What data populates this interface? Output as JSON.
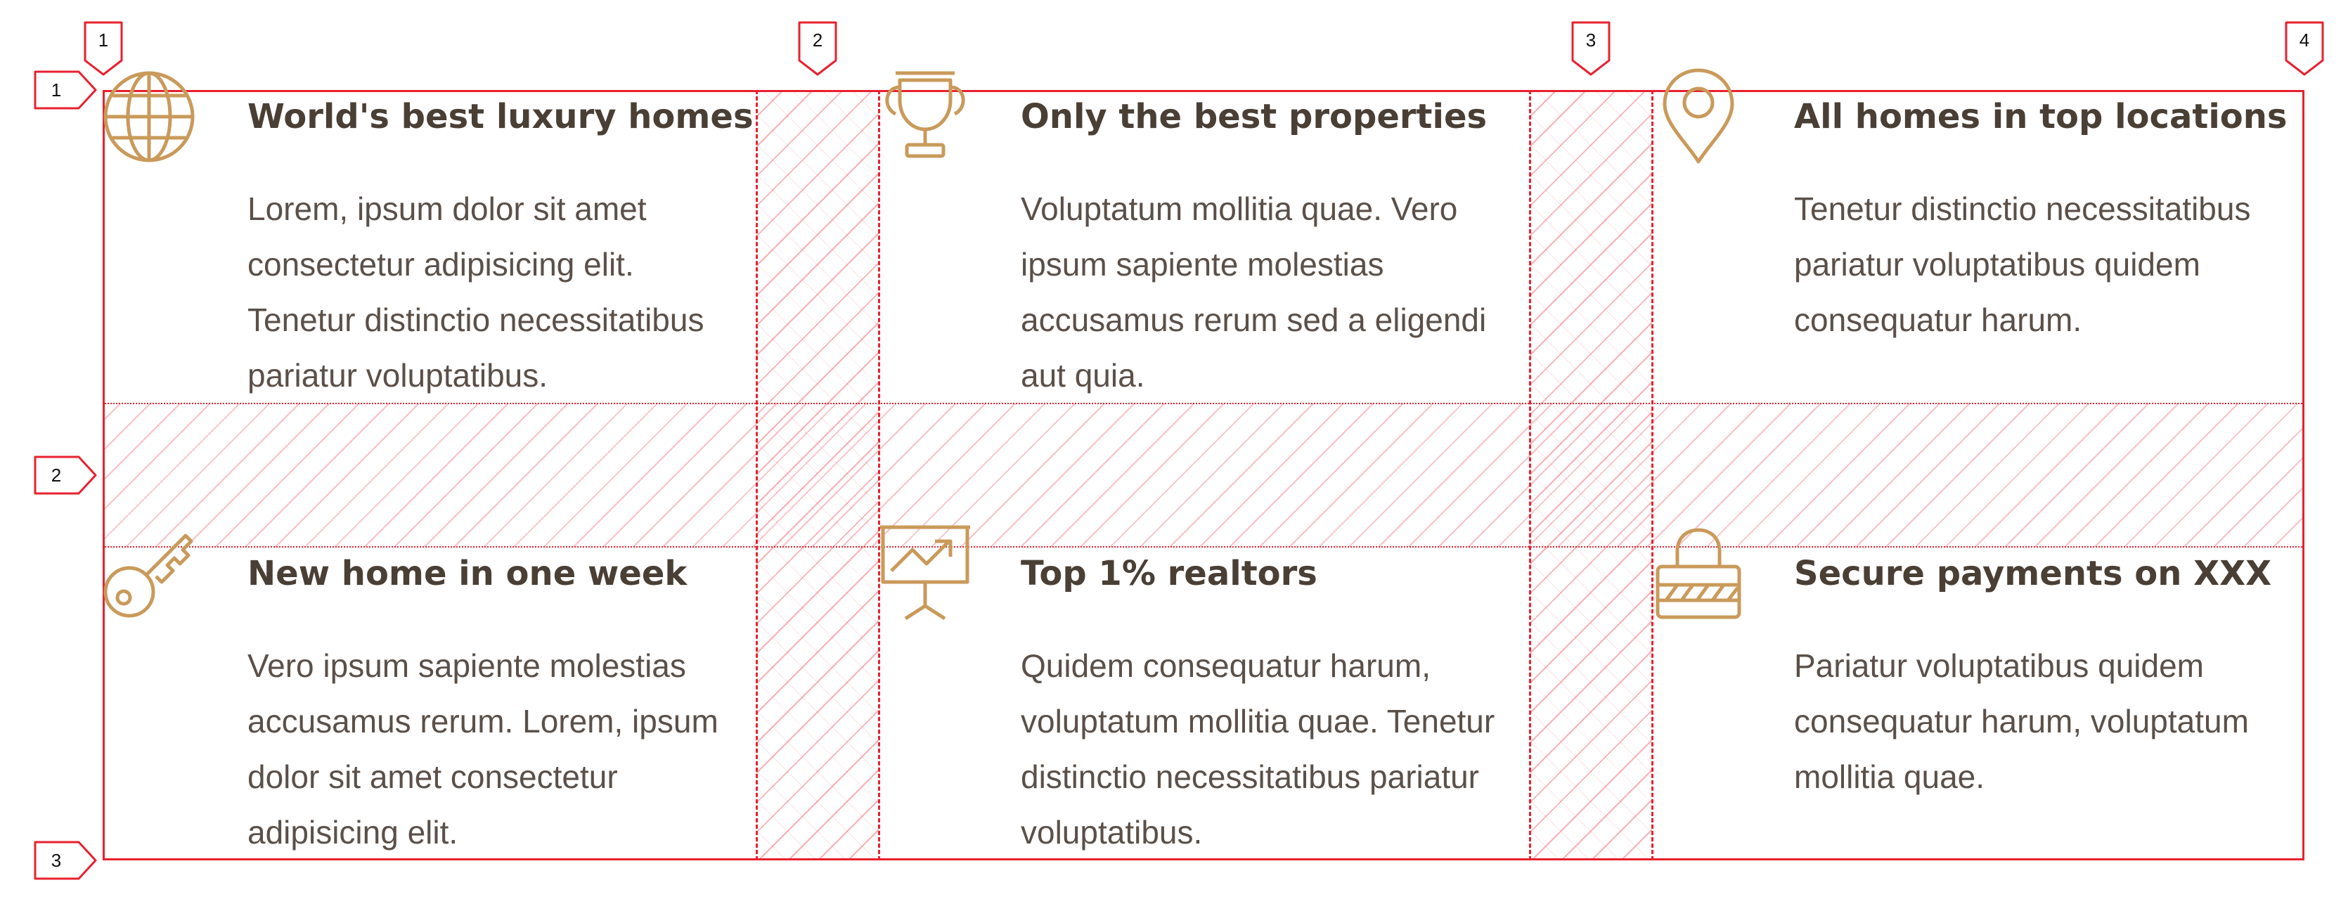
{
  "column_markers": [
    "1",
    "2",
    "3",
    "4"
  ],
  "row_markers": [
    "1",
    "2",
    "3"
  ],
  "colors": {
    "grid_line": "#e8212f",
    "icon": "#c99a5b",
    "title": "#4a3f35",
    "text": "#5b5049"
  },
  "features": [
    {
      "icon": "globe-icon",
      "title": "World's best luxury homes",
      "lines": [
        "Lorem, ipsum dolor sit amet",
        "consectetur adipisicing elit.",
        "Tenetur distinctio necessitatibus",
        "pariatur voluptatibus."
      ]
    },
    {
      "icon": "trophy-icon",
      "title": "Only the best properties",
      "lines": [
        "Voluptatum mollitia quae. Vero",
        "ipsum sapiente molestias",
        "accusamus rerum sed a eligendi",
        "aut quia."
      ]
    },
    {
      "icon": "map-pin-icon",
      "title": "All homes in top locations",
      "lines": [
        "Tenetur distinctio necessitatibus",
        "pariatur voluptatibus quidem",
        "consequatur harum."
      ]
    },
    {
      "icon": "key-icon",
      "title": "New home in one week",
      "lines": [
        "Vero ipsum sapiente molestias",
        "accusamus rerum. Lorem, ipsum",
        "dolor sit amet consectetur",
        "adipisicing elit."
      ]
    },
    {
      "icon": "presentation-chart-icon",
      "title": "Top 1% realtors",
      "lines": [
        "Quidem consequatur harum,",
        "voluptatum mollitia quae. Tenetur",
        "distinctio necessitatibus pariatur",
        "voluptatibus."
      ]
    },
    {
      "icon": "padlock-icon",
      "title": "Secure payments on XXX",
      "lines": [
        "Pariatur voluptatibus quidem",
        "consequatur harum, voluptatum",
        "mollitia quae."
      ]
    }
  ]
}
